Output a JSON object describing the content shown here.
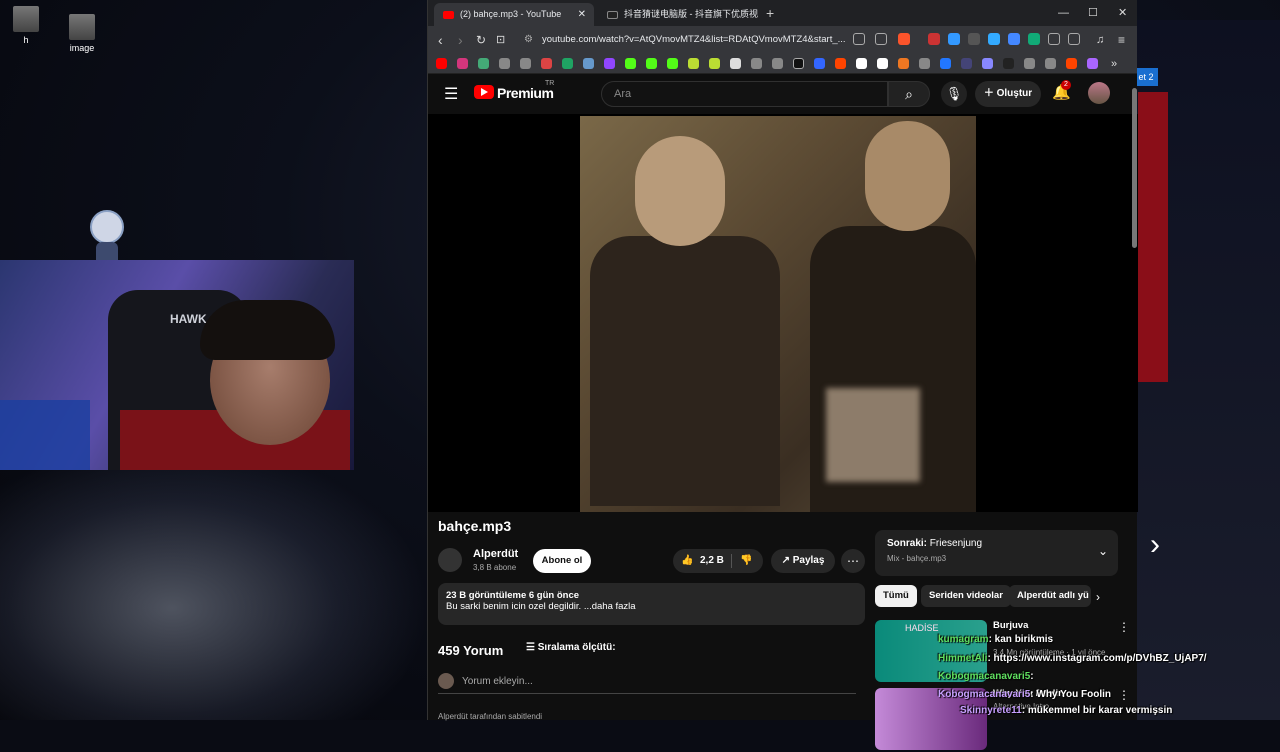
{
  "desktop": {
    "icons": [
      {
        "label": "h"
      },
      {
        "label": "image"
      }
    ]
  },
  "browser": {
    "tabs": [
      {
        "label": "(2) bahçe.mp3 - YouTube",
        "active": true
      },
      {
        "label": "抖音猜谜电脑版 - 抖音旗下优质视频"
      }
    ],
    "url": "youtube.com/watch?v=AtQVmovMTZ4&list=RDAtQVmovMTZ4&start_..."
  },
  "yt": {
    "logo": "Premium",
    "region": "TR",
    "search_placeholder": "Ara",
    "create": "Oluştur",
    "notif_count": "2",
    "video": {
      "title": "bahçe.mp3",
      "channel": "Alperdüt",
      "subs": "3,8 B abone",
      "subscribe": "Abone ol",
      "likes": "2,2 B",
      "share": "Paylaş",
      "views_line": "23 B görüntüleme  6 gün önce",
      "desc": "Bu sarki benim icin ozel degildir. ...daha fazla"
    },
    "comments": {
      "count": "459 Yorum",
      "sort": "Sıralama ölçütü:",
      "add": "Yorum ekleyin...",
      "pinned": "Alperdüt tarafından sabitlendi"
    },
    "next": {
      "label": "Sonraki:",
      "title": "Friesenjung",
      "sub": "Mix - bahçe.mp3"
    },
    "chips": [
      "Tümü",
      "Seriden videolar",
      "Alperdüt adlı yü"
    ],
    "videos": [
      {
        "title": "Burjuva",
        "meta": "3,4 Mn görüntüleme · 1 yıl önce",
        "thumb": "HADİSE"
      },
      {
        "title": "Why You Foolin",
        "meta": "Alternative Intro"
      }
    ]
  },
  "chat": [
    {
      "user": "kumagram",
      "msg": ": kan birikmis"
    },
    {
      "user": "HimmetAli",
      "msg": ": https://www.instagram.com/p/DVhBZ_UjAP7/"
    },
    {
      "user": "Kobogmacanavari5",
      "msg": ":"
    },
    {
      "user": "Kobogmacanavari5",
      "msg": ": Why You Foolin"
    },
    {
      "user": "Skinnyrete11",
      "msg": ": mükemmel bir karar vermişsin"
    }
  ],
  "stream": {
    "overlay_tag": "et 2",
    "chair_brand": "HAWK"
  }
}
